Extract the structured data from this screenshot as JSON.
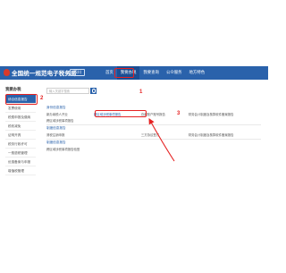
{
  "header": {
    "title": "全国统一规范电子税务局",
    "region": "四川",
    "nav": [
      "首页",
      "我要办税",
      "我要查询",
      "公众服务",
      "地方特色"
    ]
  },
  "search": {
    "placeholder": "输入关键字搜索"
  },
  "sidebar": {
    "heading": "我要办税",
    "items": [
      "综合信息报告",
      "发票使用",
      "税费申报及缴纳",
      "税收减免",
      "证明开具",
      "税务行政许可",
      "一般退税管理",
      "优惠备案与申报",
      "增值税管理"
    ]
  },
  "content": {
    "section1": "身份信息报告",
    "rows1": [
      [
        "新办纳税人开业",
        "跨区域涉税事项报告",
        "存款账户账号报告",
        "财务会计制度及核算软件备案报告"
      ],
      [
        "跨区域涉税事项报告",
        "",
        "",
        ""
      ]
    ],
    "section2": "制度信息报告",
    "rows2": [
      [
        "清税注销申报",
        "",
        "三方协议签订",
        "财务会计制度及核算软件备案报告"
      ]
    ],
    "section3": "制度信息报告",
    "rows3": [
      [
        "跨区域涉税事项报告验登",
        "",
        "",
        ""
      ]
    ]
  },
  "annotations": [
    "1",
    "2",
    "3"
  ],
  "colors": {
    "brand_blue": "#2a62ab",
    "annotation_red": "#e52222"
  }
}
